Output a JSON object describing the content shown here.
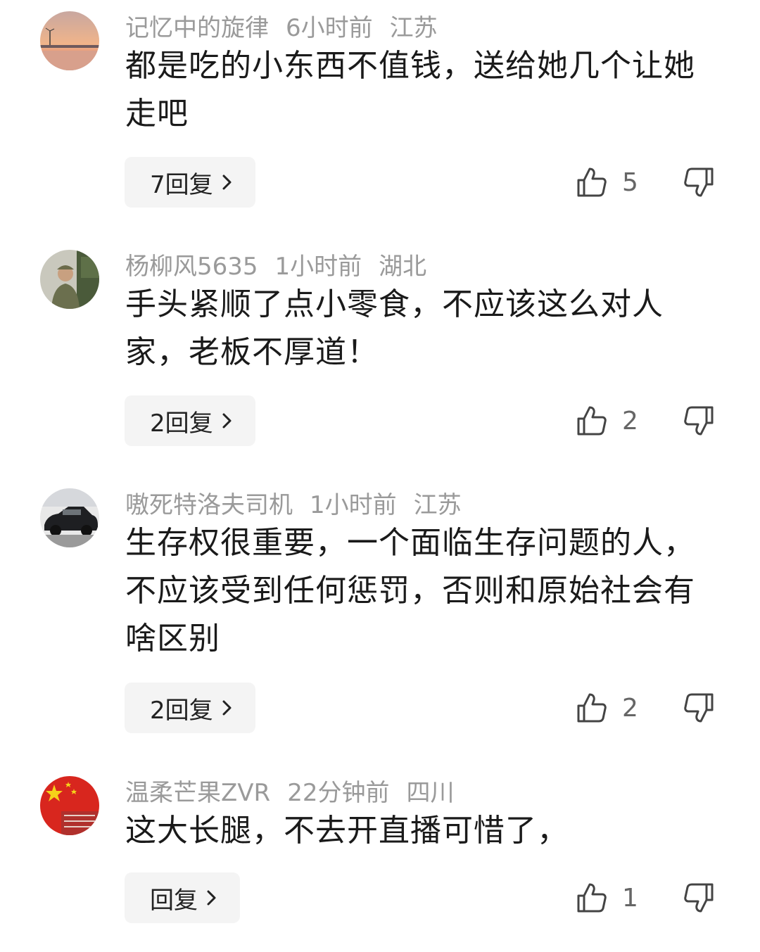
{
  "comments": [
    {
      "username": "记忆中的旋律",
      "time": "6小时前",
      "location": "江苏",
      "text": "都是吃的小东西不值钱，送给她几个让她走吧",
      "reply_label": "7回复",
      "likes": "5",
      "avatar": "sunset-beach-avatar"
    },
    {
      "username": "杨柳风5635",
      "time": "1小时前",
      "location": "湖北",
      "text": "手头紧顺了点小零食，不应该这么对人家，老板不厚道！",
      "reply_label": "2回复",
      "likes": "2",
      "avatar": "soldier-avatar"
    },
    {
      "username": "嗷死特洛夫司机",
      "time": "1小时前",
      "location": "江苏",
      "text": "生存权很重要，一个面临生存问题的人，不应该受到任何惩罚，否则和原始社会有啥区别",
      "reply_label": "2回复",
      "likes": "2",
      "avatar": "black-car-avatar"
    },
    {
      "username": "温柔芒果ZVR",
      "time": "22分钟前",
      "location": "四川",
      "text": "这大长腿，不去开直播可惜了，",
      "reply_label": "回复",
      "likes": "1",
      "avatar": "china-flag-avatar"
    }
  ],
  "icons": {
    "like": "thumbs-up-icon",
    "dislike": "thumbs-down-icon",
    "chevron": "chevron-right-icon"
  },
  "colors": {
    "meta_text": "#9a9a9a",
    "body_text": "#1a1a1a",
    "button_bg": "#f4f4f4"
  }
}
